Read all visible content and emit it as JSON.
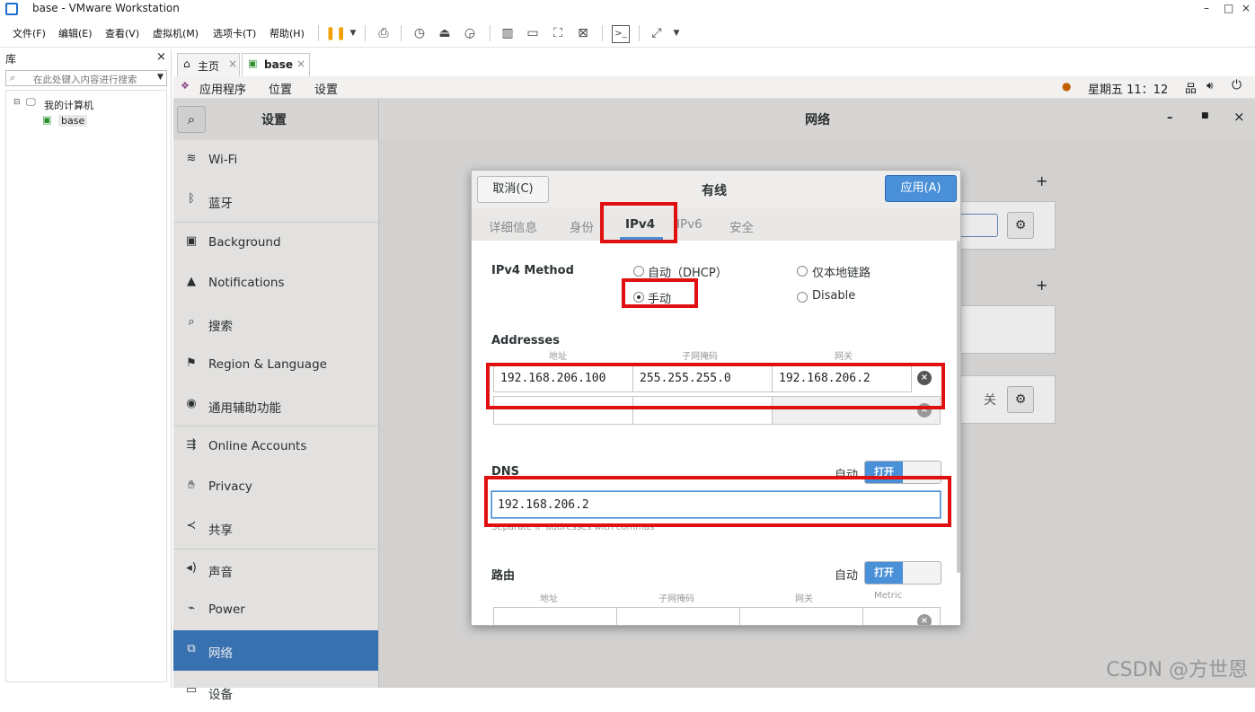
{
  "window": {
    "title": "base - VMware Workstation",
    "min": "–",
    "max": "□",
    "close": "×"
  },
  "menubar": [
    "文件(F)",
    "编辑(E)",
    "查看(V)",
    "虚拟机(M)",
    "选项卡(T)",
    "帮助(H)"
  ],
  "library": {
    "title": "库",
    "close": "×",
    "search_placeholder": "在此处键入内容进行搜索",
    "tree_root": "我的计算机",
    "tree_child": "base"
  },
  "vm_tabs": [
    {
      "label": "主页"
    },
    {
      "label": "base"
    }
  ],
  "gnome_top": {
    "apps": "应用程序",
    "places": "位置",
    "settings": "设置",
    "clock": "星期五 11：12"
  },
  "settings": {
    "header_left": "设置",
    "header_right": "网络",
    "sidebar": [
      {
        "label": "Wi-Fi",
        "icon": "wifi-icon"
      },
      {
        "label": "蓝牙",
        "icon": "bluetooth-icon"
      },
      {
        "label": "Background",
        "icon": "background-icon"
      },
      {
        "label": "Notifications",
        "icon": "bell-icon"
      },
      {
        "label": "搜索",
        "icon": "search-icon"
      },
      {
        "label": "Region & Language",
        "icon": "flag-icon"
      },
      {
        "label": "通用辅助功能",
        "icon": "accessibility-icon"
      },
      {
        "label": "Online Accounts",
        "icon": "accounts-icon"
      },
      {
        "label": "Privacy",
        "icon": "hand-icon"
      },
      {
        "label": "共享",
        "icon": "share-icon"
      },
      {
        "label": "声音",
        "icon": "speaker-icon"
      },
      {
        "label": "Power",
        "icon": "power-icon"
      },
      {
        "label": "网络",
        "icon": "network-icon"
      },
      {
        "label": "设备",
        "icon": "device-icon"
      }
    ],
    "proxy_off": "关",
    "add": "+"
  },
  "dialog": {
    "title": "有线",
    "cancel": "取消(C)",
    "apply": "应用(A)",
    "tabs": [
      "详细信息",
      "身份",
      "IPv4",
      "IPv6",
      "安全"
    ],
    "active_tab": "IPv4",
    "ipv4_method_label": "IPv4 Method",
    "methods": {
      "auto_dhcp": "自动（DHCP）",
      "link_local": "仅本地链路",
      "manual": "手动",
      "disable": "Disable"
    },
    "selected_method": "手动",
    "addresses_label": "Addresses",
    "address_cols": [
      "地址",
      "子网掩码",
      "网关"
    ],
    "address_row": {
      "address": "192.168.206.100",
      "netmask": "255.255.255.0",
      "gateway": "192.168.206.2"
    },
    "dns_label": "DNS",
    "dns_auto_label": "自动",
    "dns_toggle": "打开",
    "dns_value": "192.168.206.2",
    "dns_hint": "Separate IP addresses with commas",
    "routes_label": "路由",
    "routes_auto_label": "自动",
    "routes_toggle": "打开",
    "route_cols": [
      "地址",
      "子网掩码",
      "网关",
      "Metric"
    ]
  },
  "watermark": "CSDN @方世恩"
}
